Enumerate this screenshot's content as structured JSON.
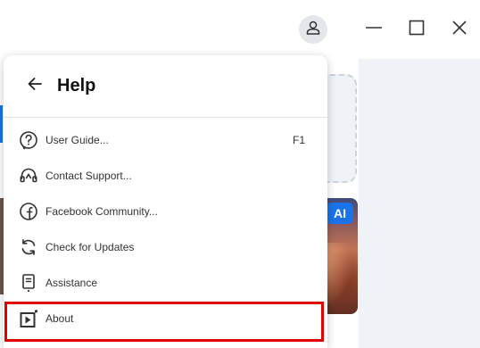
{
  "window": {
    "user_icon": "user-icon",
    "minimize_icon": "minimize-icon",
    "maximize_icon": "maximize-icon",
    "close_icon": "close-icon"
  },
  "background": {
    "ai_badge": "AI"
  },
  "help_menu": {
    "title": "Help",
    "back_icon": "arrow-left-icon",
    "items": [
      {
        "label": "User Guide...",
        "shortcut": "F1",
        "icon": "question-bubble-icon"
      },
      {
        "label": "Contact Support...",
        "shortcut": "",
        "icon": "headset-icon"
      },
      {
        "label": "Facebook Community...",
        "shortcut": "",
        "icon": "facebook-icon"
      },
      {
        "label": "Check for Updates",
        "shortcut": "",
        "icon": "refresh-icon"
      },
      {
        "label": "Assistance",
        "shortcut": "",
        "icon": "document-icon"
      },
      {
        "label": "About",
        "shortcut": "",
        "icon": "play-info-icon"
      }
    ]
  },
  "colors": {
    "highlight_border": "#e00000",
    "accent": "#1a73e8"
  }
}
